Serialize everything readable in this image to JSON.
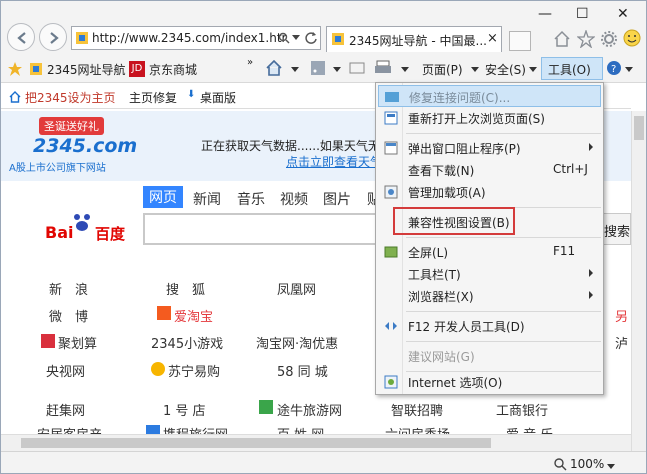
{
  "browser": {
    "address": "http://www.2345.com/index1.htr",
    "tab_title": "2345网址导航 - 中国最...",
    "window_controls": [
      "—",
      "☐",
      "✕"
    ]
  },
  "favorites": {
    "items": [
      "2345网址导航",
      "京东商城"
    ]
  },
  "commandbar": {
    "page": "页面(P)",
    "safety": "安全(S)",
    "tools": "工具(O)"
  },
  "page": {
    "top_links": [
      "把2345设为主页",
      "主页修复",
      "桌面版"
    ],
    "weather_text": "正在获取天气数据......如果天气无法",
    "weather_link": "点击立即查看天气",
    "logo_text": "2345.com",
    "logo_banner": "圣诞送好礼",
    "logo_sub": "A股上市公司旗下网站",
    "baidu_label": "百度",
    "baidu_tabs": [
      "网页",
      "新闻",
      "音乐",
      "视频",
      "图片",
      "贴"
    ],
    "search_button": "搜索",
    "sites": [
      [
        "新　浪",
        "搜　狐",
        "凤凰网"
      ],
      [
        "微　博",
        "爱淘宝",
        ""
      ],
      [
        "聚划算",
        "2345小游戏",
        "淘宝网·淘优惠"
      ],
      [
        "央视网",
        "苏宁易购",
        "58 同 城"
      ],
      [
        "赶集网",
        "1 号 店",
        "途牛旅游网",
        "智联招聘",
        "工商银行"
      ],
      [
        "安居客房产",
        "携程旅行网",
        "百 姓 网",
        "六间房秀场",
        "爱 音 乐"
      ]
    ],
    "edge_chars": [
      "另",
      "泸"
    ]
  },
  "status": {
    "zoom": "100%"
  },
  "menu": {
    "items": [
      {
        "label": "修复连接问题(C)...",
        "state": "highlight"
      },
      {
        "label": "重新打开上次浏览页面(S)"
      },
      {
        "label": "弹出窗口阻止程序(P)",
        "arrow": true
      },
      {
        "label": "查看下载(N)",
        "shortcut": "Ctrl+J"
      },
      {
        "label": "管理加载项(A)"
      },
      {
        "label": "兼容性视图设置(B)",
        "boxed": true
      },
      {
        "label": "全屏(L)",
        "shortcut": "F11"
      },
      {
        "label": "工具栏(T)",
        "arrow": true
      },
      {
        "label": "浏览器栏(X)",
        "arrow": true
      },
      {
        "label": "F12 开发人员工具(D)"
      },
      {
        "label": "建议网站(G)",
        "disabled": true
      },
      {
        "label": "Internet 选项(O)"
      }
    ]
  },
  "colors": {
    "accent": "#1a6fce",
    "highlight_box": "#d43b3b",
    "menu_highlight": "#cfe5f8"
  }
}
